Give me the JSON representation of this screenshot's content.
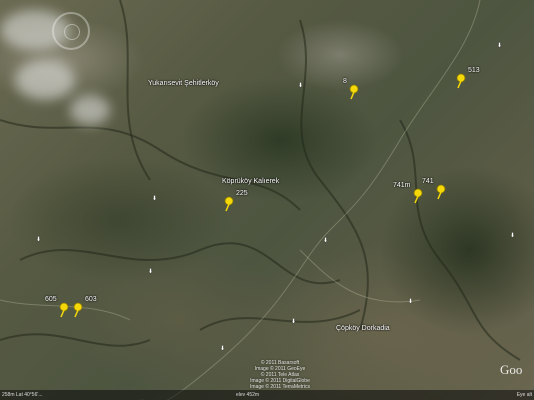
{
  "places": [
    {
      "name": "Yukarısevit Şehitlerköy",
      "id": "place-yukari"
    },
    {
      "name": "Köprüköy Kalıerek",
      "id": "place-koprukoy"
    },
    {
      "name": "Çöpköy Dorkadia",
      "id": "place-dorkadia"
    }
  ],
  "pins": [
    {
      "label": "8",
      "id": "pin-8"
    },
    {
      "label": "513",
      "id": "pin-513"
    },
    {
      "label": "741m",
      "id": "pin-741m"
    },
    {
      "label": "741",
      "id": "pin-741"
    },
    {
      "label": "225",
      "id": "pin-225"
    },
    {
      "label": "605",
      "id": "pin-605"
    },
    {
      "label": "603",
      "id": "pin-603"
    }
  ],
  "copyright": "© 2011 Basarsoft\nImage © 2011 GeoEye\n© 2011 Tele Atlas\nImage © 2011 DigitalGlobe\nImage © 2011 TerraMetrics",
  "status": {
    "left": "258m  Lat 40°56'...",
    "mid": "elev 452m",
    "right": "Eye alt"
  },
  "logo": "Goo",
  "colors": {
    "pin": "#f5d80a",
    "label": "#ffffff",
    "status_bar": "#1a1a1a"
  }
}
